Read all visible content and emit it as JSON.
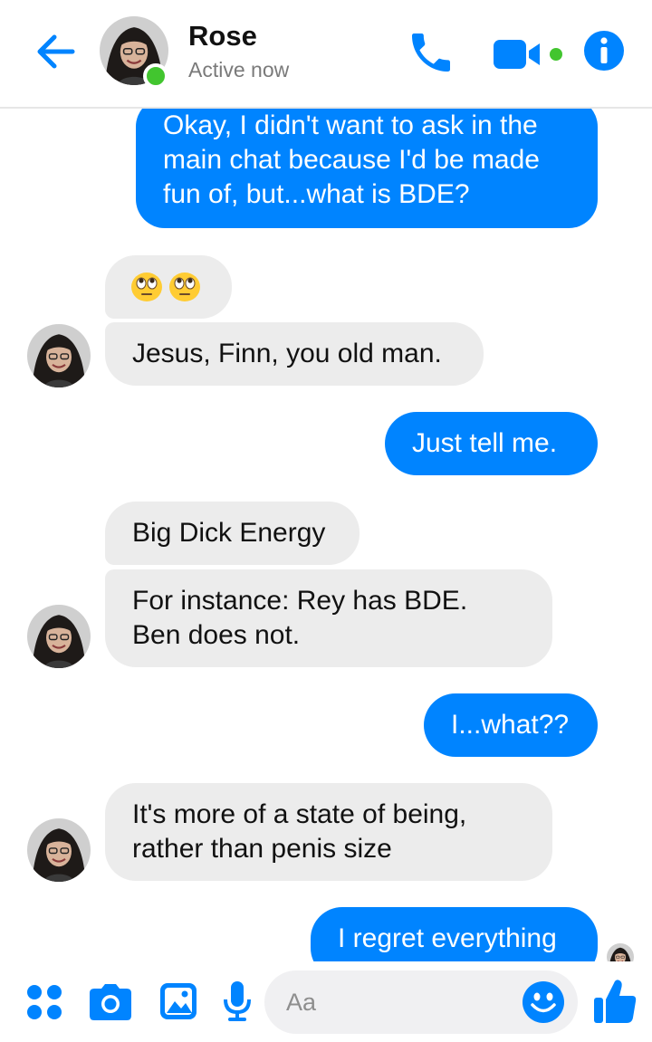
{
  "header": {
    "contact_name": "Rose",
    "status": "Active now"
  },
  "messages": [
    {
      "side": "out",
      "lines": [
        "Okay, I didn't want to ask in the",
        "main chat because I'd be made",
        "fun of, but...what is BDE?"
      ]
    },
    {
      "side": "in",
      "text": "🙄🙄",
      "kind": "emoji"
    },
    {
      "side": "in",
      "text": "Jesus, Finn, you old man."
    },
    {
      "side": "out",
      "text": "Just tell me."
    },
    {
      "side": "in",
      "text": "Big Dick Energy"
    },
    {
      "side": "in",
      "lines": [
        "For instance: Rey has BDE.",
        "Ben does not."
      ]
    },
    {
      "side": "out",
      "text": "I...what??"
    },
    {
      "side": "in",
      "lines": [
        "It's more of a state of being,",
        "rather than penis size"
      ]
    },
    {
      "side": "out",
      "text": "I regret everything"
    }
  ],
  "composer": {
    "placeholder": "Aa"
  },
  "colors": {
    "accent": "#0084ff",
    "incoming_bubble": "#ececec",
    "online": "#42c52f"
  },
  "icons": [
    "back-arrow-icon",
    "phone-icon",
    "video-camera-icon",
    "info-icon",
    "grid-dots-icon",
    "camera-icon",
    "image-icon",
    "microphone-icon",
    "smiley-icon",
    "thumbs-up-icon"
  ]
}
